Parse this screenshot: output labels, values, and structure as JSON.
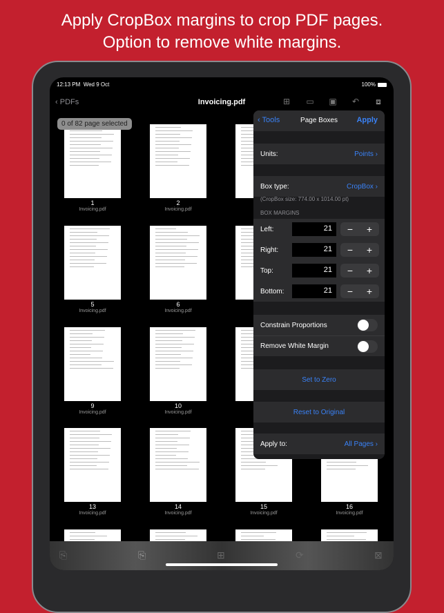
{
  "headline": [
    "Apply CropBox margins to crop PDF pages.",
    "Option to remove white margins."
  ],
  "status": {
    "time": "12:13 PM",
    "date": "Wed 9 Oct",
    "battery": "100%"
  },
  "nav": {
    "back": "PDFs",
    "title": "Invoicing.pdf"
  },
  "selection": "0 of 82 page selected",
  "pages": [
    {
      "n": "1",
      "f": "Invoicing.pdf"
    },
    {
      "n": "2",
      "f": "Invoicing.pdf"
    },
    {
      "n": "",
      "f": ""
    },
    {
      "n": "",
      "f": ""
    },
    {
      "n": "5",
      "f": "Invoicing.pdf"
    },
    {
      "n": "6",
      "f": "Invoicing.pdf"
    },
    {
      "n": "",
      "f": ""
    },
    {
      "n": "",
      "f": ""
    },
    {
      "n": "9",
      "f": "Invoicing.pdf"
    },
    {
      "n": "10",
      "f": "Invoicing.pdf"
    },
    {
      "n": "",
      "f": ""
    },
    {
      "n": "",
      "f": ""
    },
    {
      "n": "13",
      "f": "Invoicing.pdf"
    },
    {
      "n": "14",
      "f": "Invoicing.pdf"
    },
    {
      "n": "15",
      "f": "Invoicing.pdf"
    },
    {
      "n": "16",
      "f": "Invoicing.pdf"
    }
  ],
  "panel": {
    "back": "Tools",
    "title": "Page Boxes",
    "apply": "Apply",
    "units_label": "Units:",
    "units_value": "Points",
    "boxtype_label": "Box type:",
    "boxtype_value": "CropBox",
    "size_note": "(CropBox size: 774.00 x 1014.00 pt)",
    "section": "BOX MARGINS",
    "margins": [
      {
        "label": "Left:",
        "value": "21"
      },
      {
        "label": "Right:",
        "value": "21"
      },
      {
        "label": "Top:",
        "value": "21"
      },
      {
        "label": "Bottom:",
        "value": "21"
      }
    ],
    "constrain": "Constrain Proportions",
    "constrain_on": false,
    "remove_white": "Remove White Margin",
    "remove_white_on": false,
    "set_zero": "Set to Zero",
    "reset": "Reset to Original",
    "applyto_label": "Apply to:",
    "applyto_value": "All Pages",
    "minus": "−",
    "plus": "+"
  }
}
